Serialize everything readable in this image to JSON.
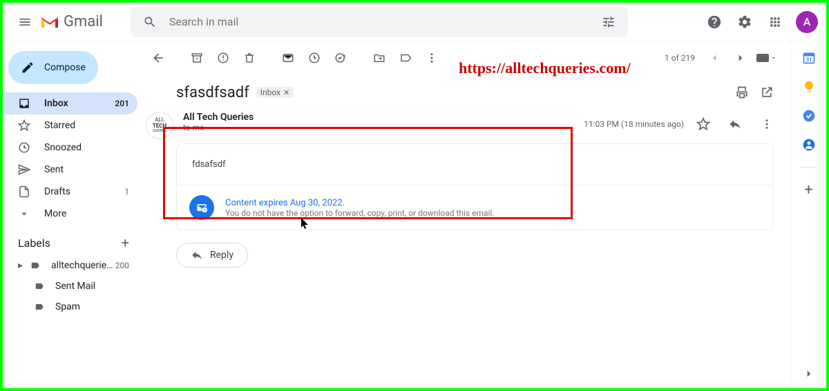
{
  "header": {
    "app_name": "Gmail",
    "search_placeholder": "Search in mail",
    "avatar_letter": "A"
  },
  "compose_label": "Compose",
  "nav": [
    {
      "icon": "inbox",
      "label": "Inbox",
      "count": "201",
      "active": true
    },
    {
      "icon": "star",
      "label": "Starred",
      "count": "",
      "active": false
    },
    {
      "icon": "clock",
      "label": "Snoozed",
      "count": "",
      "active": false
    },
    {
      "icon": "send",
      "label": "Sent",
      "count": "",
      "active": false
    },
    {
      "icon": "draft",
      "label": "Drafts",
      "count": "1",
      "active": false
    },
    {
      "icon": "more",
      "label": "More",
      "count": "",
      "active": false
    }
  ],
  "labels_header": "Labels",
  "labels": [
    {
      "label": "alltechqueries@...",
      "count": "200",
      "expandable": true
    },
    {
      "label": "Sent Mail",
      "count": "",
      "sub": true
    },
    {
      "label": "Spam",
      "count": "",
      "sub": true
    }
  ],
  "toolbar": {
    "page_counter": "1 of 219"
  },
  "message": {
    "subject": "sfasdfsadf",
    "chip_label": "Inbox",
    "sender_name": "All Tech Queries",
    "sender_to": "to me",
    "timestamp": "11:03 PM (18 minutes ago)",
    "body": "fdsafsdf",
    "confidential_title": "Content expires Aug 30, 2022.",
    "confidential_note": "You do not have the option to forward, copy, print, or download this email.",
    "reply_label": "Reply",
    "avatar_lines": [
      "ALL",
      "TECH",
      "QUERIES"
    ]
  },
  "overlay_url": "https://alltechqueries.com/"
}
